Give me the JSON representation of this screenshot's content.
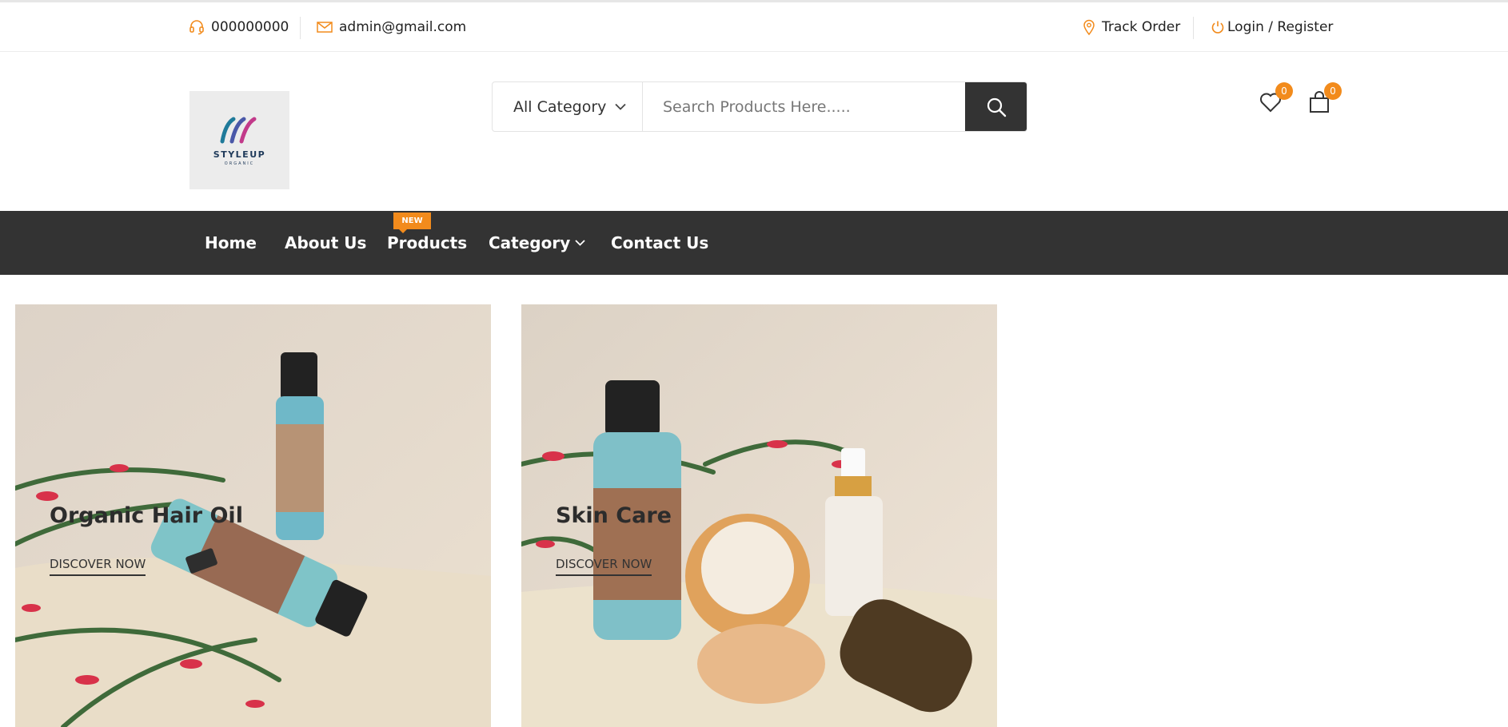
{
  "topbar": {
    "phone": "000000000",
    "email": "admin@gmail.com",
    "track_order": "Track Order",
    "login_register": "Login / Register"
  },
  "header": {
    "logo_text": "STYLEUP",
    "logo_subtext": "ORGANIC",
    "category_select": "All Category",
    "search_placeholder": "Search Products Here.....",
    "wishlist_count": "0",
    "cart_count": "0"
  },
  "nav": {
    "items": [
      {
        "label": "Home"
      },
      {
        "label": "About Us"
      },
      {
        "label": "Products",
        "tag": "NEW"
      },
      {
        "label": "Category"
      },
      {
        "label": "Contact Us"
      }
    ]
  },
  "banners": [
    {
      "title": "Organic Hair Oil",
      "link": "DISCOVER NOW"
    },
    {
      "title": "Skin Care",
      "link": "DISCOVER NOW"
    }
  ],
  "colors": {
    "accent": "#f28b1c",
    "dark": "#333333"
  }
}
